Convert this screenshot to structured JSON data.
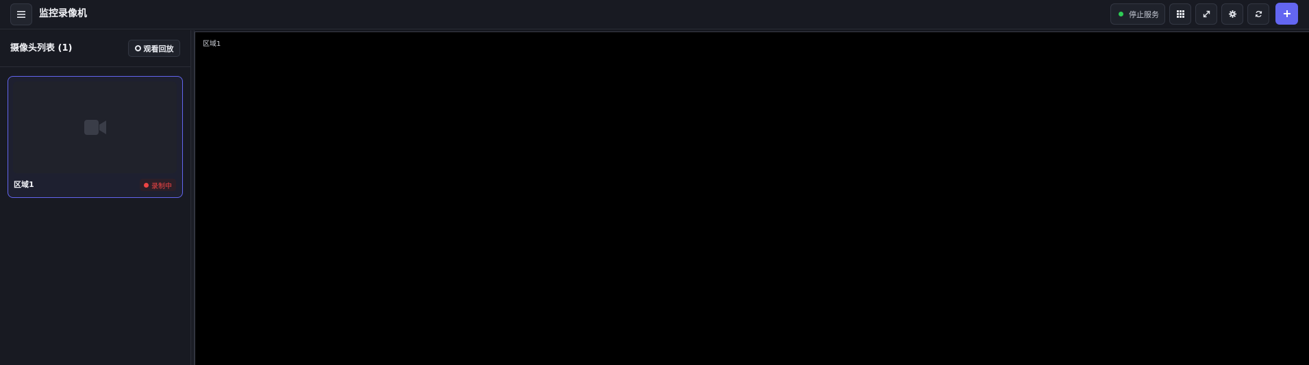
{
  "header": {
    "app_title": "监控录像机",
    "menu_icon": "hamburger-icon",
    "stop_service_label": "停止服务",
    "status_color": "#2ecc55",
    "buttons": {
      "grid_icon": "grid-icon",
      "fullscreen_icon": "expand-icon",
      "settings_icon": "gear-icon",
      "refresh_icon": "refresh-icon",
      "add_icon": "plus-icon"
    },
    "accent_color": "#6366f1"
  },
  "sidebar": {
    "title": "摄像头列表 (1)",
    "playback_label": "观看回放",
    "cameras": [
      {
        "name": "区域1",
        "status": "录制中",
        "status_color": "#ef4444",
        "icon": "video-camera-icon"
      }
    ]
  },
  "main": {
    "video_label": "区域1"
  }
}
